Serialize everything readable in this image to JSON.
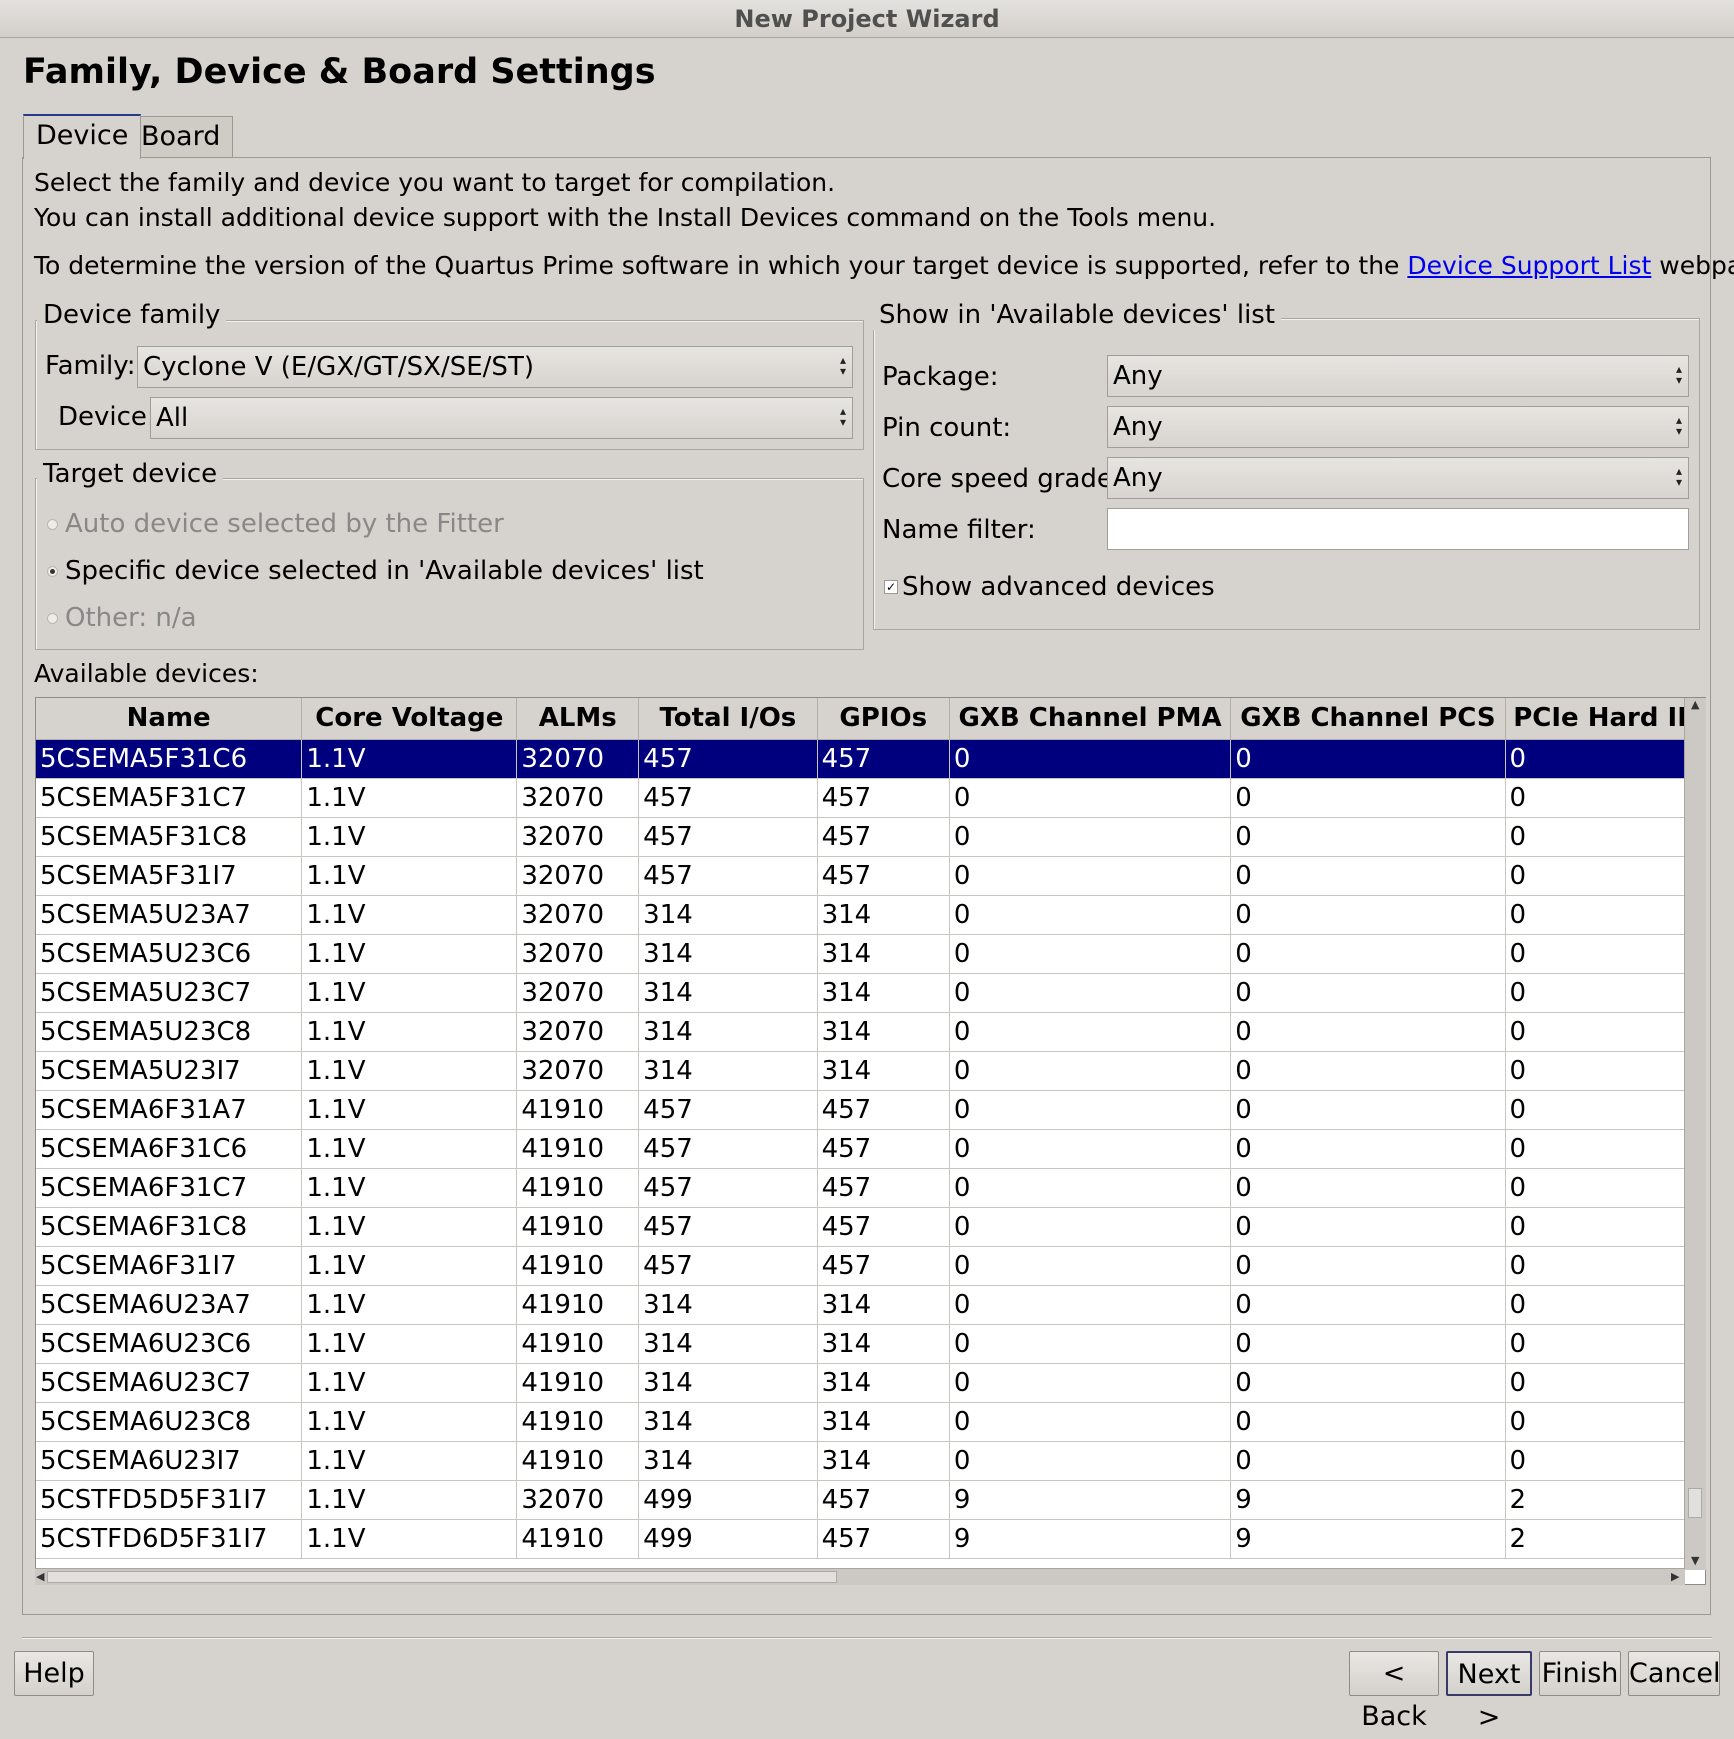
{
  "window": {
    "title": "New Project Wizard"
  },
  "page_title": "Family, Device & Board Settings",
  "tabs": [
    {
      "label": "Device",
      "active": true
    },
    {
      "label": "Board",
      "active": false
    }
  ],
  "description": {
    "line1": "Select the family and device you want to target for compilation.",
    "line2": "You can install additional device support with the Install Devices command on the Tools menu.",
    "line3_prefix": "To determine the version of the Quartus Prime software in which your target device is supported, refer to the ",
    "line3_link": "Device Support List",
    "line3_suffix": " webpage."
  },
  "device_family": {
    "title": "Device family",
    "family_label": "Family:",
    "family_value": "Cyclone V (E/GX/GT/SX/SE/ST)",
    "device_label": "Device:",
    "device_value": "All"
  },
  "target_device": {
    "title": "Target device",
    "options": [
      {
        "label": "Auto device selected by the Fitter",
        "selected": false,
        "enabled": false
      },
      {
        "label": "Specific device selected in 'Available devices' list",
        "selected": true,
        "enabled": true
      },
      {
        "label": "Other:  n/a",
        "selected": false,
        "enabled": false
      }
    ]
  },
  "filters": {
    "title": "Show in 'Available devices' list",
    "package_label": "Package:",
    "package_value": "Any",
    "pin_count_label": "Pin count:",
    "pin_count_value": "Any",
    "speed_label": "Core speed grade:",
    "speed_value": "Any",
    "name_filter_label": "Name filter:",
    "name_filter_value": "",
    "show_advanced_label": "Show advanced devices",
    "show_advanced_checked": true
  },
  "available_devices": {
    "label": "Available devices:",
    "columns": [
      "Name",
      "Core Voltage",
      "ALMs",
      "Total I/Os",
      "GPIOs",
      "GXB Channel PMA",
      "GXB Channel PCS",
      "PCIe Hard IP"
    ],
    "rows": [
      [
        "5CSEMA5F31C6",
        "1.1V",
        "32070",
        "457",
        "457",
        "0",
        "0",
        "0"
      ],
      [
        "5CSEMA5F31C7",
        "1.1V",
        "32070",
        "457",
        "457",
        "0",
        "0",
        "0"
      ],
      [
        "5CSEMA5F31C8",
        "1.1V",
        "32070",
        "457",
        "457",
        "0",
        "0",
        "0"
      ],
      [
        "5CSEMA5F31I7",
        "1.1V",
        "32070",
        "457",
        "457",
        "0",
        "0",
        "0"
      ],
      [
        "5CSEMA5U23A7",
        "1.1V",
        "32070",
        "314",
        "314",
        "0",
        "0",
        "0"
      ],
      [
        "5CSEMA5U23C6",
        "1.1V",
        "32070",
        "314",
        "314",
        "0",
        "0",
        "0"
      ],
      [
        "5CSEMA5U23C7",
        "1.1V",
        "32070",
        "314",
        "314",
        "0",
        "0",
        "0"
      ],
      [
        "5CSEMA5U23C8",
        "1.1V",
        "32070",
        "314",
        "314",
        "0",
        "0",
        "0"
      ],
      [
        "5CSEMA5U23I7",
        "1.1V",
        "32070",
        "314",
        "314",
        "0",
        "0",
        "0"
      ],
      [
        "5CSEMA6F31A7",
        "1.1V",
        "41910",
        "457",
        "457",
        "0",
        "0",
        "0"
      ],
      [
        "5CSEMA6F31C6",
        "1.1V",
        "41910",
        "457",
        "457",
        "0",
        "0",
        "0"
      ],
      [
        "5CSEMA6F31C7",
        "1.1V",
        "41910",
        "457",
        "457",
        "0",
        "0",
        "0"
      ],
      [
        "5CSEMA6F31C8",
        "1.1V",
        "41910",
        "457",
        "457",
        "0",
        "0",
        "0"
      ],
      [
        "5CSEMA6F31I7",
        "1.1V",
        "41910",
        "457",
        "457",
        "0",
        "0",
        "0"
      ],
      [
        "5CSEMA6U23A7",
        "1.1V",
        "41910",
        "314",
        "314",
        "0",
        "0",
        "0"
      ],
      [
        "5CSEMA6U23C6",
        "1.1V",
        "41910",
        "314",
        "314",
        "0",
        "0",
        "0"
      ],
      [
        "5CSEMA6U23C7",
        "1.1V",
        "41910",
        "314",
        "314",
        "0",
        "0",
        "0"
      ],
      [
        "5CSEMA6U23C8",
        "1.1V",
        "41910",
        "314",
        "314",
        "0",
        "0",
        "0"
      ],
      [
        "5CSEMA6U23I7",
        "1.1V",
        "41910",
        "314",
        "314",
        "0",
        "0",
        "0"
      ],
      [
        "5CSTFD5D5F31I7",
        "1.1V",
        "32070",
        "499",
        "457",
        "9",
        "9",
        "2"
      ],
      [
        "5CSTFD6D5F31I7",
        "1.1V",
        "41910",
        "499",
        "457",
        "9",
        "9",
        "2"
      ]
    ],
    "selected_row": 0
  },
  "buttons": {
    "help": "Help",
    "back": "< Back",
    "next": "Next >",
    "finish": "Finish",
    "cancel": "Cancel"
  },
  "colors": {
    "selection": "#00007f",
    "link": "#0000ee",
    "window_bg": "#d6d3ce"
  }
}
